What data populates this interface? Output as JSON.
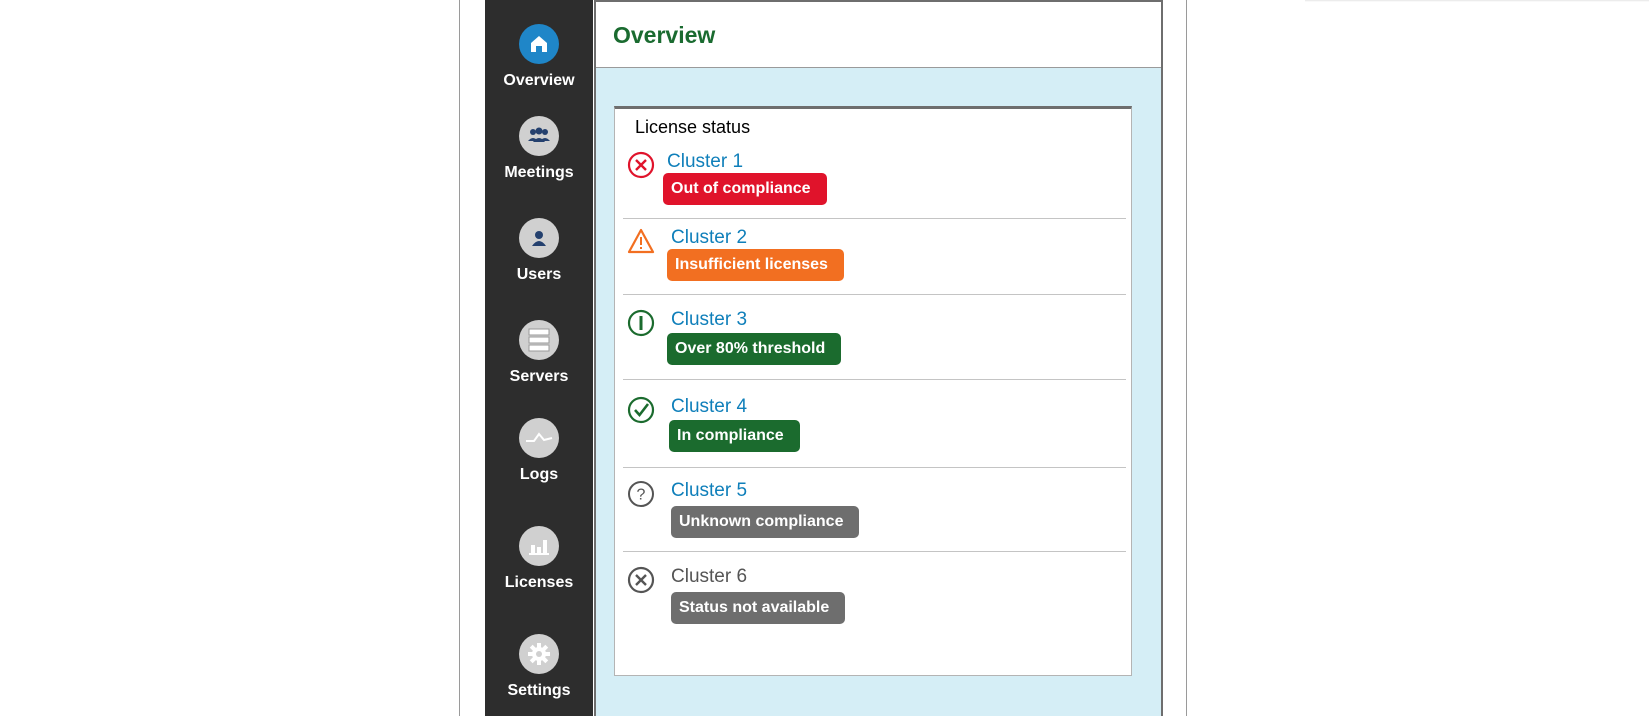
{
  "sidebar": {
    "items": [
      {
        "label": "Overview",
        "icon": "home-icon",
        "active": true
      },
      {
        "label": "Meetings",
        "icon": "people-group-icon"
      },
      {
        "label": "Users",
        "icon": "user-icon"
      },
      {
        "label": "Servers",
        "icon": "server-icon"
      },
      {
        "label": "Logs",
        "icon": "waveform-icon"
      },
      {
        "label": "Licenses",
        "icon": "bar-chart-icon"
      },
      {
        "label": "Settings",
        "icon": "gear-icon"
      }
    ]
  },
  "header": {
    "title": "Overview"
  },
  "license_status": {
    "title": "License status",
    "clusters": [
      {
        "name": "Cluster 1",
        "status": "Out of compliance",
        "icon": "error-x-icon",
        "color": "#e0132b"
      },
      {
        "name": "Cluster 2",
        "status": "Insufficient licenses",
        "icon": "warning-triangle-icon",
        "color": "#f26f21"
      },
      {
        "name": "Cluster 3",
        "status": "Over 80% threshold",
        "icon": "threshold-icon",
        "color": "#1b6b2e"
      },
      {
        "name": "Cluster 4",
        "status": "In compliance",
        "icon": "check-circle-icon",
        "color": "#1b6b2e"
      },
      {
        "name": "Cluster 5",
        "status": "Unknown compliance",
        "icon": "question-circle-icon",
        "color": "#6e6e6e"
      },
      {
        "name": "Cluster 6",
        "status": "Status not available",
        "icon": "unavailable-x-icon",
        "color": "#6e6e6e"
      }
    ]
  },
  "colors": {
    "sidebar_bg": "#2d2d2d",
    "active_nav": "#1f86c8",
    "title_green": "#1a6b30",
    "link_blue": "#0f7fba",
    "panel_bg": "#d5eef6"
  }
}
